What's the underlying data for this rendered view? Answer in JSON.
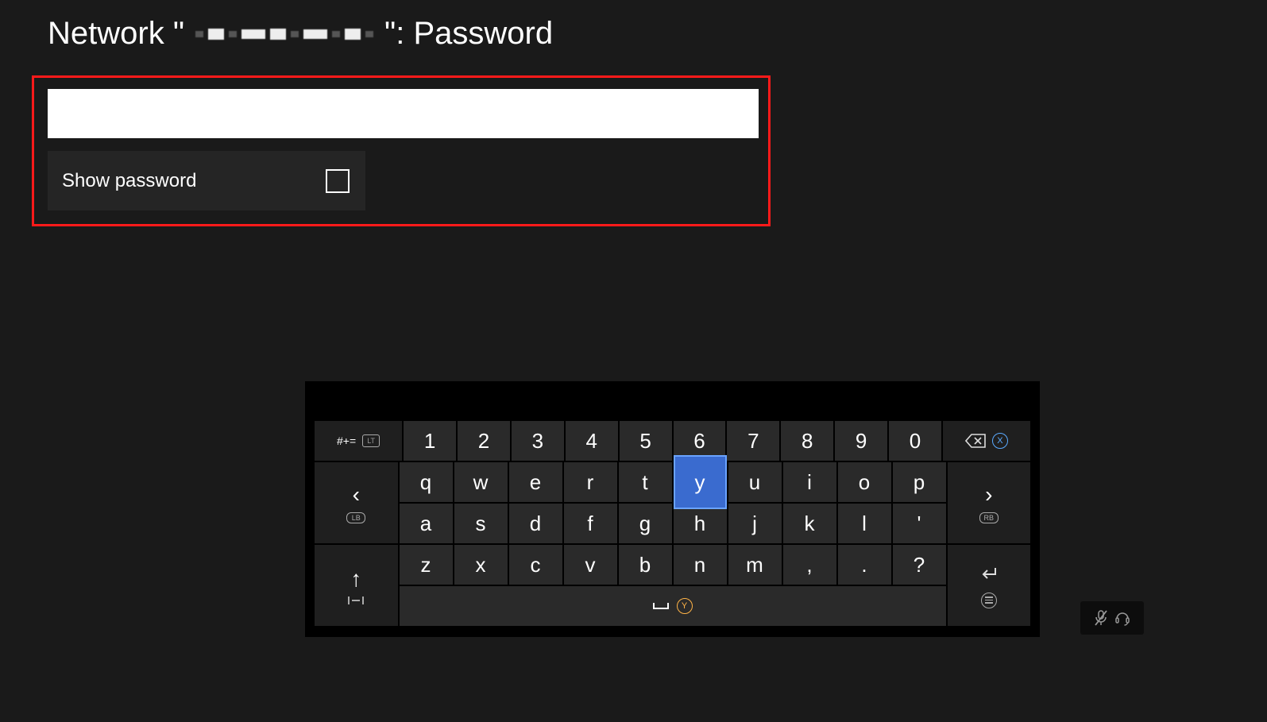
{
  "title": {
    "prefix": "Network \"",
    "suffix": "\": Password"
  },
  "password": {
    "value": "",
    "placeholder": ""
  },
  "show_password": {
    "label": "Show password",
    "checked": false
  },
  "keyboard": {
    "symkey_label": "#+=",
    "symkey_hint": "LT",
    "lb_hint": "LB",
    "rb_hint": "RB",
    "x_hint": "X",
    "y_hint": "Y",
    "row1": [
      "1",
      "2",
      "3",
      "4",
      "5",
      "6",
      "7",
      "8",
      "9",
      "0"
    ],
    "row2": [
      "q",
      "w",
      "e",
      "r",
      "t",
      "y",
      "u",
      "i",
      "o",
      "p"
    ],
    "row3": [
      "a",
      "s",
      "d",
      "f",
      "g",
      "h",
      "j",
      "k",
      "l",
      "'"
    ],
    "row4": [
      "z",
      "x",
      "c",
      "v",
      "b",
      "n",
      "m",
      ",",
      ".",
      "?"
    ],
    "highlighted_key": "y"
  }
}
